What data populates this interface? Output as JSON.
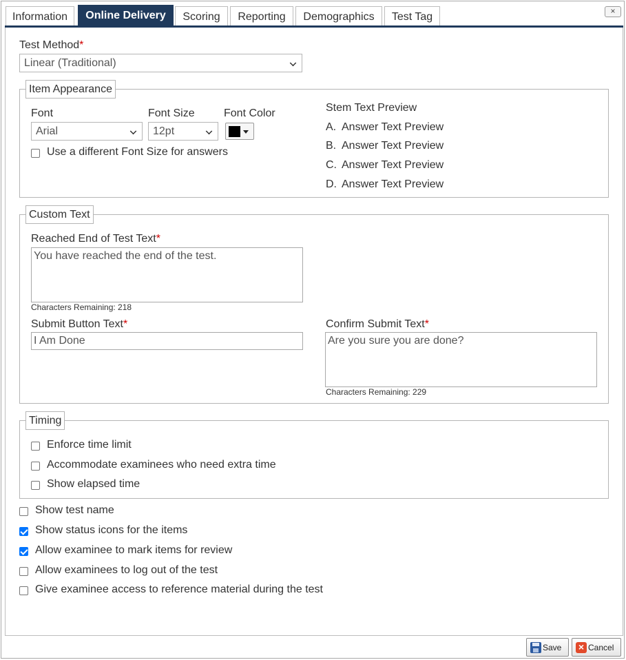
{
  "tabs": [
    {
      "label": "Information"
    },
    {
      "label": "Online Delivery"
    },
    {
      "label": "Scoring"
    },
    {
      "label": "Reporting"
    },
    {
      "label": "Demographics"
    },
    {
      "label": "Test Tag"
    }
  ],
  "close_label": "×",
  "test_method": {
    "label": "Test Method",
    "required_mark": "*",
    "value": "Linear (Traditional)"
  },
  "item_appearance": {
    "legend": "Item Appearance",
    "font_label": "Font",
    "font_value": "Arial",
    "font_size_label": "Font Size",
    "font_size_value": "12pt",
    "font_color_label": "Font Color",
    "font_color_value": "#000000",
    "different_size_label": "Use a different Font Size for answers",
    "different_size_checked": false,
    "preview": {
      "stem": "Stem Text Preview",
      "answers": [
        {
          "letter": "A.",
          "text": "Answer Text Preview"
        },
        {
          "letter": "B.",
          "text": "Answer Text Preview"
        },
        {
          "letter": "C.",
          "text": "Answer Text Preview"
        },
        {
          "letter": "D.",
          "text": "Answer Text Preview"
        }
      ]
    }
  },
  "custom_text": {
    "legend": "Custom Text",
    "end_label": "Reached End of Test Text",
    "end_value": "You have reached the end of the test.",
    "end_remaining": "Characters Remaining: 218",
    "submit_label": "Submit Button Text",
    "submit_value": "I Am Done",
    "confirm_label": "Confirm Submit Text",
    "confirm_value": "Are you sure you are done?",
    "confirm_remaining": "Characters Remaining: 229",
    "required_mark": "*"
  },
  "timing": {
    "legend": "Timing",
    "options": [
      {
        "label": "Enforce time limit",
        "checked": false
      },
      {
        "label": "Accommodate examinees who need extra time",
        "checked": false
      },
      {
        "label": "Show elapsed time",
        "checked": false
      }
    ]
  },
  "options": [
    {
      "label": "Show test name",
      "checked": false
    },
    {
      "label": "Show status icons for the items",
      "checked": true
    },
    {
      "label": "Allow examinee to mark items for review",
      "checked": true
    },
    {
      "label": "Allow examinees to log out of the test",
      "checked": false
    },
    {
      "label": "Give examinee access to reference material during the test",
      "checked": false
    }
  ],
  "buttons": {
    "save": "Save",
    "cancel": "Cancel"
  },
  "colors": {
    "accent": "#1f3a5c",
    "required": "#d00000",
    "check": "#0075ff"
  }
}
